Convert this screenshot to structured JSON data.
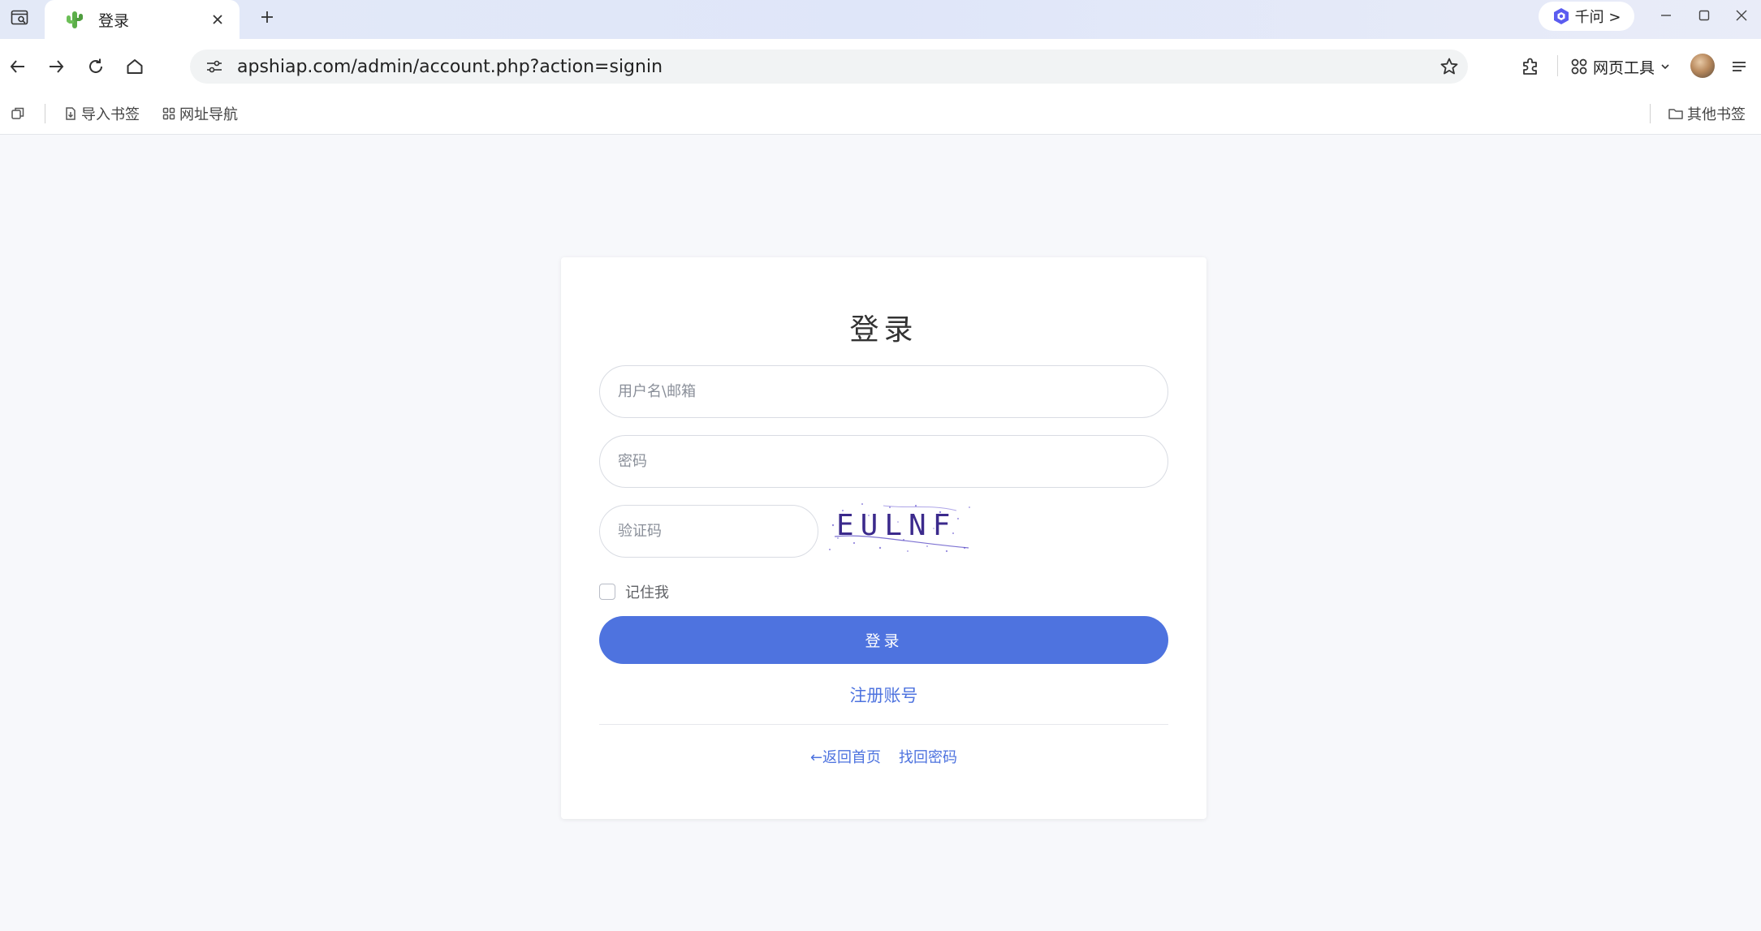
{
  "browser": {
    "tab": {
      "title": "登录"
    },
    "qianwen_label": "千问 >",
    "url": "apshiap.com/admin/account.php?action=signin",
    "webtools_label": "网页工具",
    "bookmarks": {
      "import_label": "导入书签",
      "nav_label": "网址导航",
      "other_label": "其他书签"
    }
  },
  "login": {
    "title": "登录",
    "username_placeholder": "用户名\\邮箱",
    "password_placeholder": "密码",
    "captcha_placeholder": "验证码",
    "captcha_text": "EULNF",
    "remember_label": "记住我",
    "submit_label": "登录",
    "register_link": "注册账号",
    "back_home_link": "←返回首页",
    "forgot_password_link": "找回密码"
  },
  "colors": {
    "accent": "#4e73df",
    "page_bg": "#f7f8fb",
    "captcha_text": "#3b2a8c"
  }
}
